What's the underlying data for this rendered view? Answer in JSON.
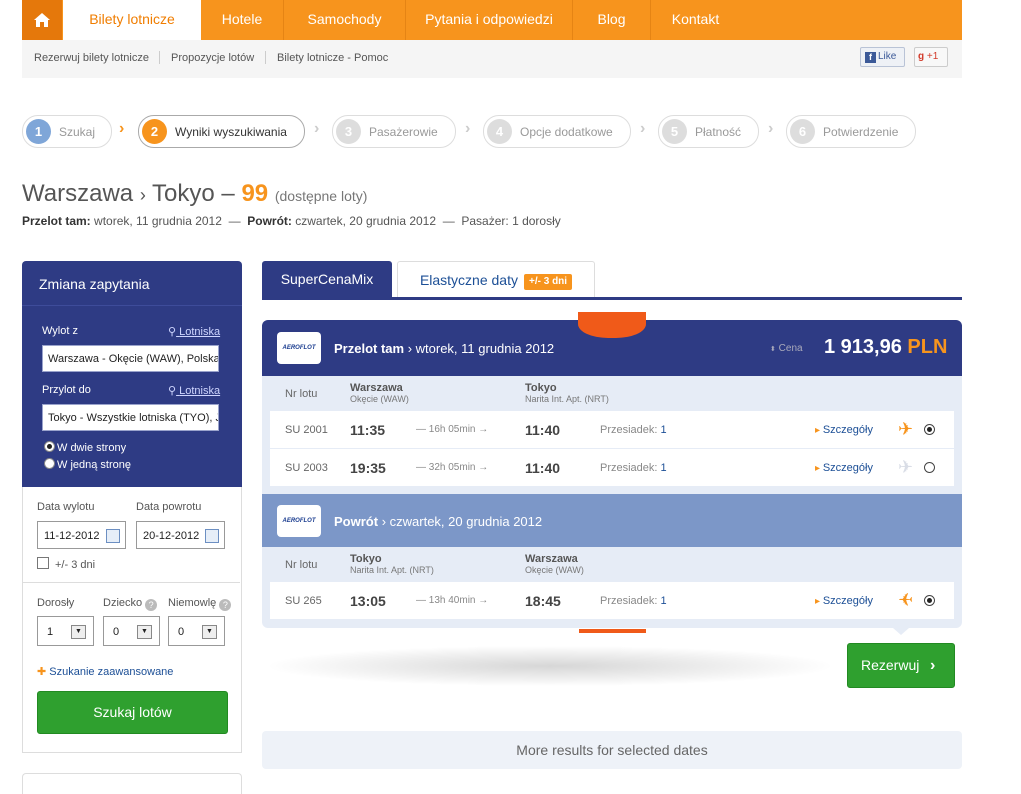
{
  "nav": {
    "tabs": [
      "Bilety lotnicze",
      "Hotele",
      "Samochody",
      "Pytania i odpowiedzi",
      "Blog",
      "Kontakt"
    ],
    "active_tab": "Bilety lotnicze"
  },
  "subnav": {
    "links": [
      "Rezerwuj bilety lotnicze",
      "Propozycje lotów",
      "Bilety lotnicze - Pomoc"
    ],
    "like_label": "Like",
    "gplus_label": "+1"
  },
  "steps": [
    {
      "num": "1",
      "label": "Szukaj"
    },
    {
      "num": "2",
      "label": "Wyniki wyszukiwania"
    },
    {
      "num": "3",
      "label": "Pasażerowie"
    },
    {
      "num": "4",
      "label": "Opcje dodatkowe"
    },
    {
      "num": "5",
      "label": "Płatność"
    },
    {
      "num": "6",
      "label": "Potwierdzenie"
    }
  ],
  "current_step": 2,
  "heading": {
    "from": "Warszawa",
    "arrow": "›",
    "to": "Tokyo",
    "dash": "–",
    "count": "99",
    "count_note": "(dostępne loty)"
  },
  "summary": {
    "out_label": "Przelot tam:",
    "out_date": "wtorek, 11 grudnia 2012",
    "ret_label": "Powrót:",
    "ret_date": "czwartek, 20 grudnia 2012",
    "pax": "Pasażer: 1 dorosły"
  },
  "search_panel": {
    "title": "Zmiana zapytania",
    "from_label": "Wylot z",
    "airports_link": "Lotniska",
    "from_value": "Warszawa - Okęcie (WAW), Polska",
    "to_label": "Przylot do",
    "to_value": "Tokyo - Wszystkie lotniska (TYO), Japonia",
    "trip_round": "W dwie strony",
    "trip_oneway": "W jedną stronę",
    "trip_selected": "round",
    "depart_label": "Data wylotu",
    "return_label": "Data powrotu",
    "depart_value": "11-12-2012",
    "return_value": "20-12-2012",
    "flex_label": "+/- 3 dni",
    "flex_checked": false,
    "adults_label": "Dorosły",
    "child_label": "Dziecko",
    "infant_label": "Niemowlę",
    "adults_value": "1",
    "child_value": "0",
    "infant_value": "0",
    "advanced_link": "Szukanie zaawansowane",
    "search_button": "Szukaj lotów"
  },
  "result_tabs": {
    "active": "SuperCenaMix",
    "other": "Elastyczne daty",
    "other_badge": "+/- 3 dni"
  },
  "outbound": {
    "airline_logo_text": "AEROFLOT",
    "title": "Przelot tam",
    "date": "› wtorek, 11 grudnia 2012",
    "price_label": "Cena",
    "price_amount": "1 913,96",
    "price_currency": "PLN",
    "col_flight": "Nr lotu",
    "col_from_city": "Warszawa",
    "col_from_airport": "Okęcie (WAW)",
    "col_to_city": "Tokyo",
    "col_to_airport": "Narita Int. Apt. (NRT)",
    "flights": [
      {
        "no": "SU 2001",
        "dep": "11:35",
        "dur": "— 16h 05min →",
        "arr": "11:40",
        "stops_label": "Przesiadek:",
        "stops": "1",
        "details": "Szczegóły",
        "selected": true
      },
      {
        "no": "SU 2003",
        "dep": "19:35",
        "dur": "— 32h 05min →",
        "arr": "11:40",
        "stops_label": "Przesiadek:",
        "stops": "1",
        "details": "Szczegóły",
        "selected": false
      }
    ]
  },
  "return": {
    "airline_logo_text": "AEROFLOT",
    "title": "Powrót",
    "date": "› czwartek, 20 grudnia 2012",
    "col_flight": "Nr lotu",
    "col_from_city": "Tokyo",
    "col_from_airport": "Narita Int. Apt. (NRT)",
    "col_to_city": "Warszawa",
    "col_to_airport": "Okęcie (WAW)",
    "flights": [
      {
        "no": "SU 265",
        "dep": "13:05",
        "dur": "— 13h 40min →",
        "arr": "18:45",
        "stops_label": "Przesiadek:",
        "stops": "1",
        "details": "Szczegóły",
        "selected": true
      }
    ]
  },
  "book_button": "Rezerwuj",
  "more_results": "More results for selected dates",
  "icons": {
    "home": "home-icon",
    "plane": "airplane-icon",
    "search_key": "key-icon",
    "calendar": "calendar-icon",
    "plus": "plus-icon"
  },
  "colors": {
    "brand_orange": "#f7941d",
    "navy": "#2e3b84",
    "green": "#2fa02f"
  }
}
